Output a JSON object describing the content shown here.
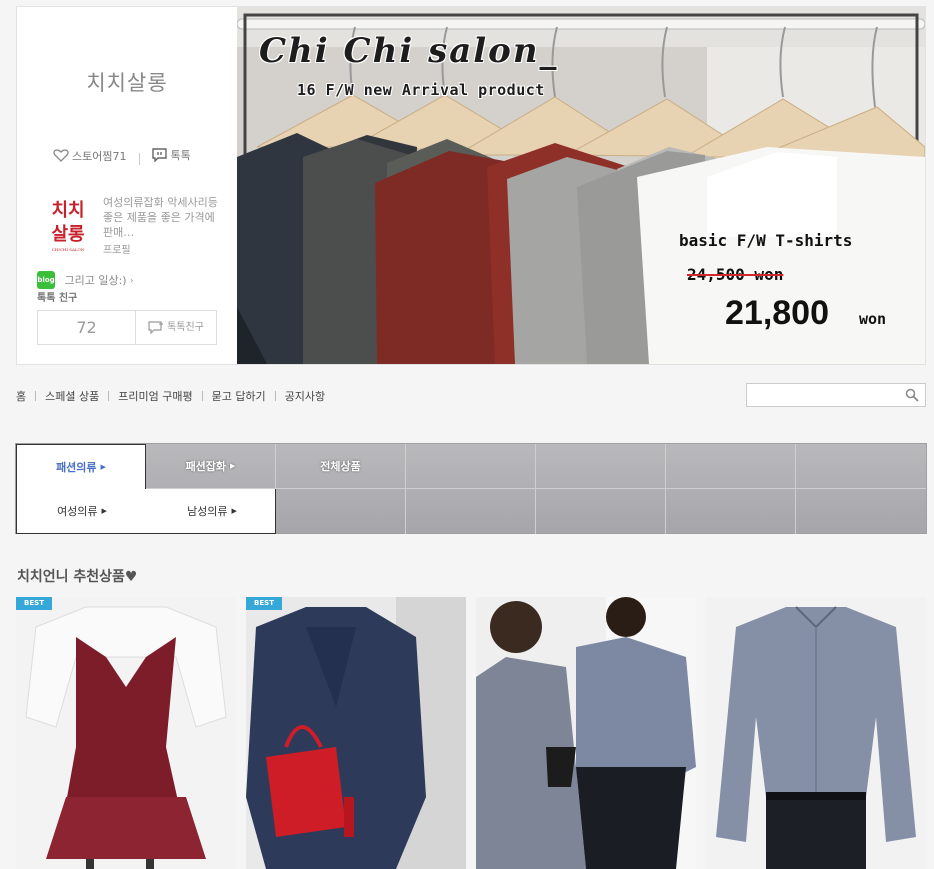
{
  "profile": {
    "store_name": "치치살롱",
    "wish_label": "스토어찜71",
    "talk_label": "톡톡",
    "logo_line1": "치치",
    "logo_line2": "살롱",
    "logo_sub": "CHICHI SALON",
    "description": "여성의류잡화 악세사리등 좋은 제품을 좋은 가격에 판매…",
    "profile_link": "프로필",
    "blog_badge": "blog",
    "blog_text": "그리고 일상:)",
    "talk_friend_label": "톡톡 친구",
    "friend_count": "72",
    "friend_button": "톡톡친구"
  },
  "banner": {
    "title": "Chi Chi salon_",
    "subtitle": "16 F/W new Arrival product",
    "product": "basic F/W T-shirts",
    "old_price": "24,500 won",
    "new_price": "21,800",
    "new_price_unit": "won"
  },
  "nav": {
    "items": [
      "홈",
      "스페셜 상품",
      "프리미엄 구매평",
      "묻고 답하기",
      "공지사항"
    ]
  },
  "search": {
    "placeholder": ""
  },
  "categories": {
    "top": [
      "패션의류",
      "패션잡화",
      "전체상품"
    ],
    "sub": [
      "여성의류",
      "남성의류"
    ],
    "arrow": "▶"
  },
  "recommended": {
    "title": "치치언니 추천상품♥",
    "badge": "BEST"
  },
  "colors": {
    "active_category": "#4a6fc7",
    "best_badge": "#35a7d8",
    "blog": "#3bbf3b",
    "logo": "#c7212c"
  }
}
